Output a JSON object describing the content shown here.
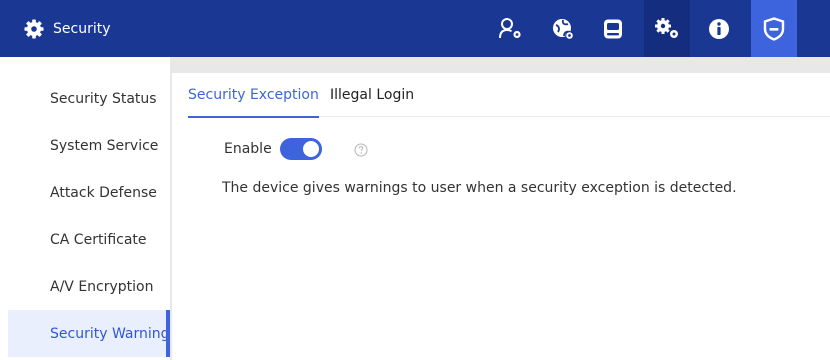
{
  "header": {
    "title": "Security",
    "icons": [
      {
        "name": "account-icon",
        "shaded": false,
        "active": false
      },
      {
        "name": "network-icon",
        "shaded": false,
        "active": false
      },
      {
        "name": "storage-icon",
        "shaded": false,
        "active": false
      },
      {
        "name": "system-settings-icon",
        "shaded": true,
        "active": false
      },
      {
        "name": "info-icon",
        "shaded": false,
        "active": false
      },
      {
        "name": "security-shield-icon",
        "shaded": false,
        "active": true
      }
    ]
  },
  "sidebar": {
    "items": [
      {
        "label": "Security Status"
      },
      {
        "label": "System Service"
      },
      {
        "label": "Attack Defense"
      },
      {
        "label": "CA Certificate"
      },
      {
        "label": "A/V Encryption"
      },
      {
        "label": "Security Warning",
        "selected": true
      }
    ]
  },
  "main": {
    "tabs": [
      {
        "label": "Security Exception",
        "active": true
      },
      {
        "label": "Illegal Login",
        "active": false
      }
    ],
    "enable_label": "Enable",
    "enable_on": true,
    "description": "The device gives warnings to user when a security exception is detected."
  },
  "colors": {
    "header_bg": "#1a3794",
    "accent": "#3d64dd",
    "selected_bg": "#e9effc"
  }
}
